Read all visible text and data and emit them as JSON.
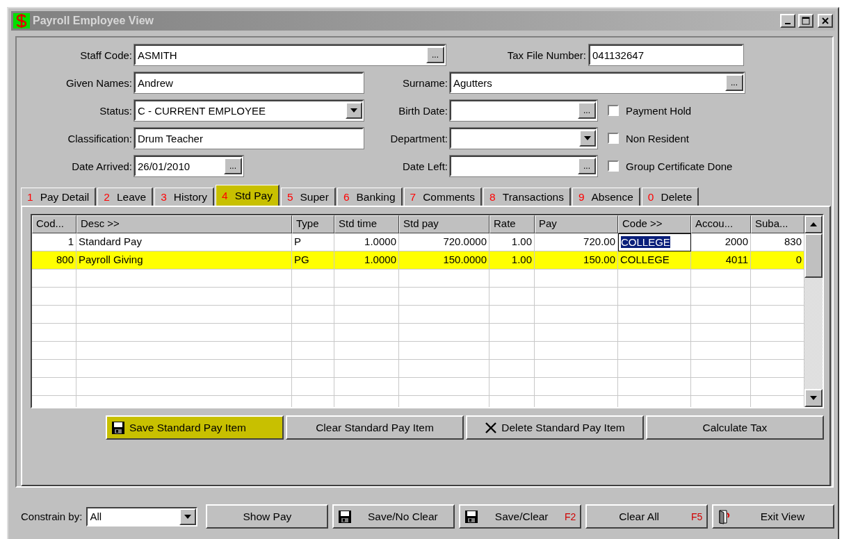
{
  "window": {
    "title": "Payroll Employee View"
  },
  "form": {
    "staff_code": {
      "label": "Staff Code:",
      "value": "ASMITH"
    },
    "tax_file_number": {
      "label": "Tax File Number:",
      "value": "041132647"
    },
    "given_names": {
      "label": "Given Names:",
      "value": "Andrew"
    },
    "surname": {
      "label": "Surname:",
      "value": "Agutters"
    },
    "status": {
      "label": "Status:",
      "value": "C - CURRENT EMPLOYEE"
    },
    "birth_date": {
      "label": "Birth Date:"
    },
    "classification": {
      "label": "Classification:",
      "value": "Drum Teacher"
    },
    "department": {
      "label": "Department:"
    },
    "date_arrived": {
      "label": "Date Arrived:",
      "value": "26/01/2010"
    },
    "date_left": {
      "label": "Date Left:"
    },
    "ellipsis": "...",
    "checkboxes": [
      {
        "label": "Payment Hold",
        "checked": false
      },
      {
        "label": "Non Resident",
        "checked": false
      },
      {
        "label": "Group Certificate Done",
        "checked": false
      }
    ]
  },
  "tabs": [
    {
      "key": "1",
      "label": "Pay Detail",
      "selected": false
    },
    {
      "key": "2",
      "label": "Leave",
      "selected": false
    },
    {
      "key": "3",
      "label": "History",
      "selected": false
    },
    {
      "key": "4",
      "label": "Std Pay",
      "selected": true
    },
    {
      "key": "5",
      "label": "Super",
      "selected": false
    },
    {
      "key": "6",
      "label": "Banking",
      "selected": false
    },
    {
      "key": "7",
      "label": "Comments",
      "selected": false
    },
    {
      "key": "8",
      "label": "Transactions",
      "selected": false
    },
    {
      "key": "9",
      "label": "Absence",
      "selected": false
    },
    {
      "key": "0",
      "label": "Delete",
      "selected": false
    }
  ],
  "table": {
    "columns": [
      "Cod...",
      "Desc >>",
      "Type",
      "Std time",
      "Std pay",
      "Rate",
      "Pay",
      "Code >>",
      "Accou...",
      "Suba..."
    ],
    "rows": [
      {
        "selected": false,
        "cells": [
          {
            "text": "1",
            "focused": false
          },
          {
            "text": "Standard Pay",
            "focused": false
          },
          {
            "text": "P",
            "focused": false
          },
          {
            "text": "1.0000",
            "focused": false
          },
          {
            "text": "720.0000",
            "focused": false
          },
          {
            "text": "1.00",
            "focused": false
          },
          {
            "text": "720.00",
            "focused": false
          },
          {
            "text": "COLLEGE",
            "focused": true
          },
          {
            "text": "2000",
            "focused": false
          },
          {
            "text": "830",
            "focused": false
          }
        ]
      },
      {
        "selected": true,
        "cells": [
          {
            "text": "800",
            "focused": false
          },
          {
            "text": "Payroll Giving",
            "focused": false
          },
          {
            "text": "PG",
            "focused": false
          },
          {
            "text": "1.0000",
            "focused": false
          },
          {
            "text": "150.0000",
            "focused": false
          },
          {
            "text": "1.00",
            "focused": false
          },
          {
            "text": "150.00",
            "focused": false
          },
          {
            "text": "COLLEGE",
            "focused": false
          },
          {
            "text": "4011",
            "focused": false
          },
          {
            "text": "0",
            "focused": false
          }
        ]
      }
    ]
  },
  "panel_buttons": [
    {
      "kind": "save",
      "label": "Save Standard Pay Item",
      "highlighted": true
    },
    {
      "kind": "plain",
      "label": "Clear Standard Pay Item",
      "highlighted": false
    },
    {
      "kind": "delete",
      "label": "Delete Standard Pay Item",
      "highlighted": false
    },
    {
      "kind": "plain",
      "label": "Calculate Tax",
      "highlighted": false
    }
  ],
  "footer": {
    "constrain_label": "Constrain by:",
    "constrain_value": "All",
    "buttons": [
      {
        "kind": "plain",
        "label": "Show Pay"
      },
      {
        "kind": "save",
        "label": "Save/No Clear"
      },
      {
        "kind": "save",
        "label": "Save/Clear",
        "shortcut": "F2"
      },
      {
        "kind": "plain",
        "label": "Clear All",
        "shortcut": "F5"
      },
      {
        "kind": "exit",
        "label": "Exit View"
      }
    ]
  }
}
